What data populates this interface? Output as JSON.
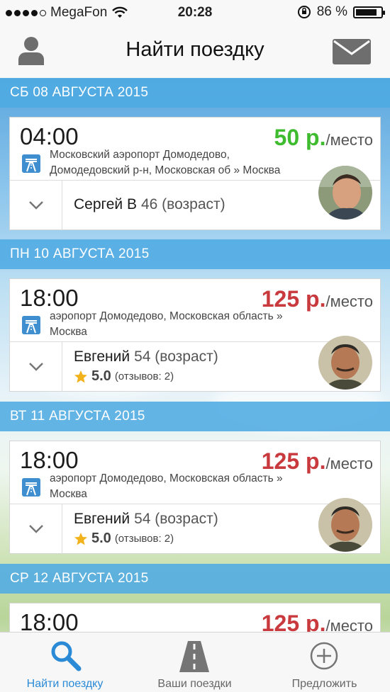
{
  "status": {
    "carrier": "MegaFon",
    "time": "20:28",
    "battery": "86 %",
    "battery_level": 0.86
  },
  "nav": {
    "title": "Найти поездку",
    "left_icon": "user-icon",
    "right_icon": "mail-icon"
  },
  "trips": [
    {
      "date": "СБ 08 АВГУСТА 2015",
      "time": "04:00",
      "price": "50 р.",
      "price_unit": "/место",
      "price_color": "#3ebb2f",
      "route_line1": "Московский аэропорт Домодедово,",
      "route_line2": "Домодедовский р-н, Московская об » Москва",
      "driver": "Сергей В",
      "age": "46 (возраст)"
    },
    {
      "date": "ПН 10 АВГУСТА 2015",
      "time": "18:00",
      "price": "125 р.",
      "price_unit": "/место",
      "price_color": "#c93a3e",
      "route_line1": "аэропорт Домодедово, Московская область »",
      "route_line2": "Москва",
      "driver": "Евгений",
      "age": "54 (возраст)",
      "rating": "5.0",
      "reviews": "(отзывов: 2)"
    },
    {
      "date": "ВТ 11 АВГУСТА 2015",
      "time": "18:00",
      "price": "125 р.",
      "price_unit": "/место",
      "price_color": "#c93a3e",
      "route_line1": "аэропорт Домодедово, Московская область »",
      "route_line2": "Москва",
      "driver": "Евгений",
      "age": "54 (возраст)",
      "rating": "5.0",
      "reviews": "(отзывов: 2)"
    },
    {
      "date": "СР 12 АВГУСТА 2015",
      "time": "18:00",
      "price": "125 р.",
      "price_unit": "/место",
      "price_color": "#c93a3e"
    }
  ],
  "tabs": [
    {
      "label": "Найти поездку",
      "icon": "search-icon",
      "active": true
    },
    {
      "label": "Ваши поездки",
      "icon": "road-icon",
      "active": false
    },
    {
      "label": "Предложить",
      "icon": "plus-circle-icon",
      "active": false
    }
  ],
  "colors": {
    "accent": "#2a8ad6",
    "date_header": "#4fabe2"
  }
}
